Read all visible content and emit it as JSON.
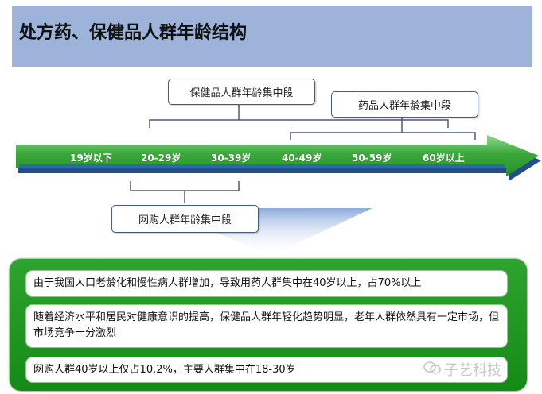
{
  "title": "处方药、保健品人群年龄结构",
  "segments": {
    "health_products": "保健品人群年龄集中段",
    "medicine": "药品人群年龄集中段",
    "online_shopping": "网购人群年龄集中段"
  },
  "ages": [
    "19岁以下",
    "20-29岁",
    "30-39岁",
    "40-49岁",
    "50-59岁",
    "60岁以上"
  ],
  "notes": [
    "由于我国人口老龄化和慢性病人群增加，导致用药人群集中在40岁以上，占70%以上",
    "随着经济水平和居民对健康意识的提高，保健品人群年轻化趋势明显，老年人群依然具有一定市场，但市场竞争十分激烈",
    "网购人群40岁以上仅占10.2%，主要人群集中在18-30岁"
  ],
  "watermark": "子艺科技",
  "colors": {
    "title_bar": "#9db3d9",
    "arrow": "#3aa93a",
    "panel": "#1e961e"
  }
}
